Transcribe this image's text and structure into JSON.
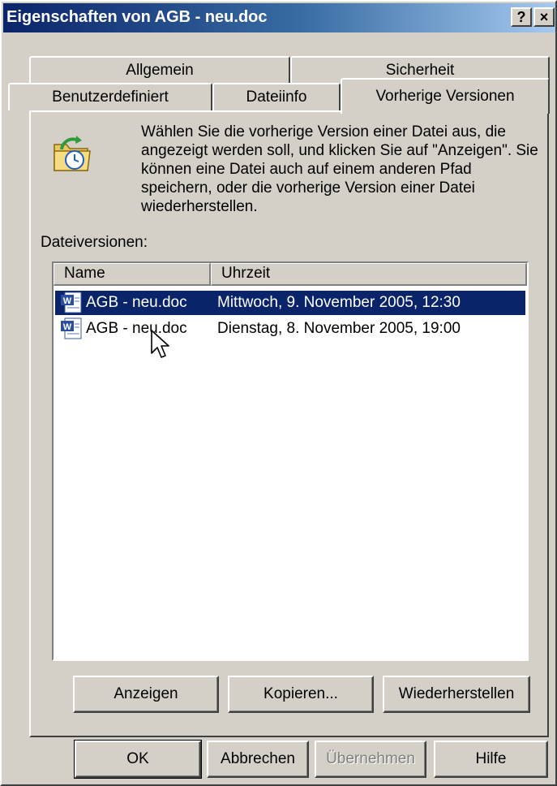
{
  "dialog": {
    "title": "Eigenschaften von AGB - neu.doc",
    "help_button": "?",
    "close_button": "×"
  },
  "tabs": [
    {
      "label": "Allgemein",
      "active": false
    },
    {
      "label": "Sicherheit",
      "active": false
    },
    {
      "label": "Benutzerdefiniert",
      "active": false
    },
    {
      "label": "Dateiinfo",
      "active": false
    },
    {
      "label": "Vorherige Versionen",
      "active": true
    }
  ],
  "panel": {
    "description": "Wählen Sie die vorherige Version einer Datei aus, die angezeigt werden soll, und klicken Sie auf \"Anzeigen\". Sie können eine Datei auch auf einem anderen Pfad speichern, oder die vorherige Version einer Datei wiederherstellen.",
    "versions_label": "Dateiversionen:",
    "columns": [
      "Name",
      "Uhrzeit"
    ],
    "versions": [
      {
        "name": "AGB - neu.doc",
        "time": "Mittwoch, 9. November 2005, 12:30",
        "selected": true
      },
      {
        "name": "AGB - neu.doc",
        "time": "Dienstag, 8. November 2005, 19:00",
        "selected": false
      }
    ],
    "buttons": {
      "view": "Anzeigen",
      "copy": "Kopieren...",
      "restore": "Wiederherstellen"
    }
  },
  "footer_buttons": {
    "ok": "OK",
    "cancel": "Abbrechen",
    "apply": "Übernehmen",
    "help": "Hilfe"
  },
  "colors": {
    "title_bar": "#0a246a",
    "selection": "#0a246a",
    "face": "#d4d0c8"
  },
  "icons": [
    "previous-versions-folder-icon",
    "word-document-icon",
    "mouse-cursor-icon"
  ]
}
